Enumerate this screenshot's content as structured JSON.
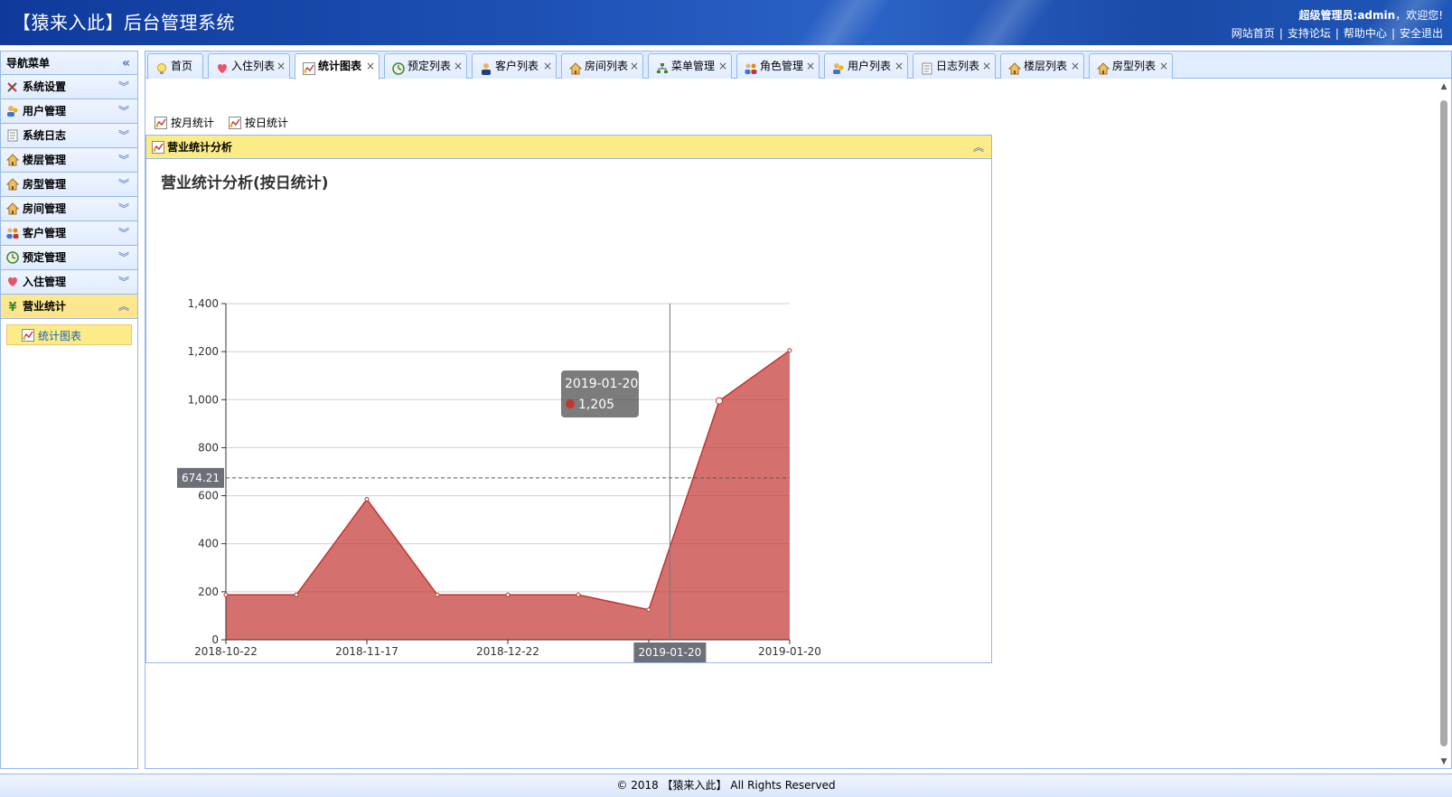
{
  "header": {
    "title": "【猿来入此】后台管理系统",
    "welcome_role": "超级管理员:admin",
    "welcome_text": "，欢迎您!",
    "links": [
      "网站首页",
      "支持论坛",
      "帮助中心",
      "安全退出"
    ],
    "link_separator": "|"
  },
  "sidebar": {
    "title": "导航菜单",
    "collapse_glyph": "«",
    "items": [
      {
        "label": "系统设置",
        "icon": "tools-icon",
        "expanded": false
      },
      {
        "label": "用户管理",
        "icon": "user-icon",
        "expanded": false
      },
      {
        "label": "系统日志",
        "icon": "log-icon",
        "expanded": false
      },
      {
        "label": "楼层管理",
        "icon": "house-icon",
        "expanded": false
      },
      {
        "label": "房型管理",
        "icon": "house-icon",
        "expanded": false
      },
      {
        "label": "房间管理",
        "icon": "house-icon",
        "expanded": false
      },
      {
        "label": "客户管理",
        "icon": "group-icon",
        "expanded": false
      },
      {
        "label": "预定管理",
        "icon": "clock-icon",
        "expanded": false
      },
      {
        "label": "入住管理",
        "icon": "heart-icon",
        "expanded": false
      },
      {
        "label": "营业统计",
        "icon": "yen-icon",
        "expanded": true
      }
    ],
    "subitems": [
      {
        "label": "统计图表",
        "icon": "chart-icon"
      }
    ]
  },
  "tabs": [
    {
      "label": "首页",
      "icon": "bulb-icon",
      "closable": false,
      "active": false
    },
    {
      "label": "入住列表",
      "icon": "heart-icon",
      "closable": true,
      "active": false
    },
    {
      "label": "统计图表",
      "icon": "chart-icon",
      "closable": true,
      "active": true
    },
    {
      "label": "预定列表",
      "icon": "clock-icon",
      "closable": true,
      "active": false
    },
    {
      "label": "客户列表",
      "icon": "person-icon",
      "closable": true,
      "active": false
    },
    {
      "label": "房间列表",
      "icon": "house-icon",
      "closable": true,
      "active": false
    },
    {
      "label": "菜单管理",
      "icon": "tree-icon",
      "closable": true,
      "active": false
    },
    {
      "label": "角色管理",
      "icon": "group-icon",
      "closable": true,
      "active": false
    },
    {
      "label": "用户列表",
      "icon": "user-icon",
      "closable": true,
      "active": false
    },
    {
      "label": "日志列表",
      "icon": "log-icon",
      "closable": true,
      "active": false
    },
    {
      "label": "楼层列表",
      "icon": "house-icon",
      "closable": true,
      "active": false
    },
    {
      "label": "房型列表",
      "icon": "house-icon",
      "closable": true,
      "active": false
    }
  ],
  "tab_close_glyph": "×",
  "toolbar": {
    "month_label": "按月统计",
    "day_label": "按日统计"
  },
  "panel": {
    "title": "营业统计分析",
    "collapse_glyph": "︽"
  },
  "chart_data": {
    "type": "area",
    "title": "营业统计分析(按日统计)",
    "x_tick_labels": [
      "2018-10-22",
      "2018-11-17",
      "2018-12-22",
      "20",
      "2019-01-20"
    ],
    "y_ticks": [
      0,
      200,
      400,
      600,
      800,
      1000,
      1200,
      1400
    ],
    "ylim": [
      0,
      1400
    ],
    "values": [
      187,
      187,
      585,
      187,
      187,
      187,
      125,
      995,
      1205
    ],
    "series_color": "#c23531",
    "grid": true,
    "axis_pointer": {
      "y_label": "674.21",
      "x_label": "2019-01-20",
      "y_value": 674.21,
      "x_position_index": 6.3
    },
    "tooltip": {
      "title": "2019-01-20",
      "value": "1,205"
    }
  },
  "footer": {
    "text": "© 2018 【猿来入此】 All Rights Reserved"
  },
  "scrollbar": {
    "up": "▲",
    "down": "▼"
  }
}
